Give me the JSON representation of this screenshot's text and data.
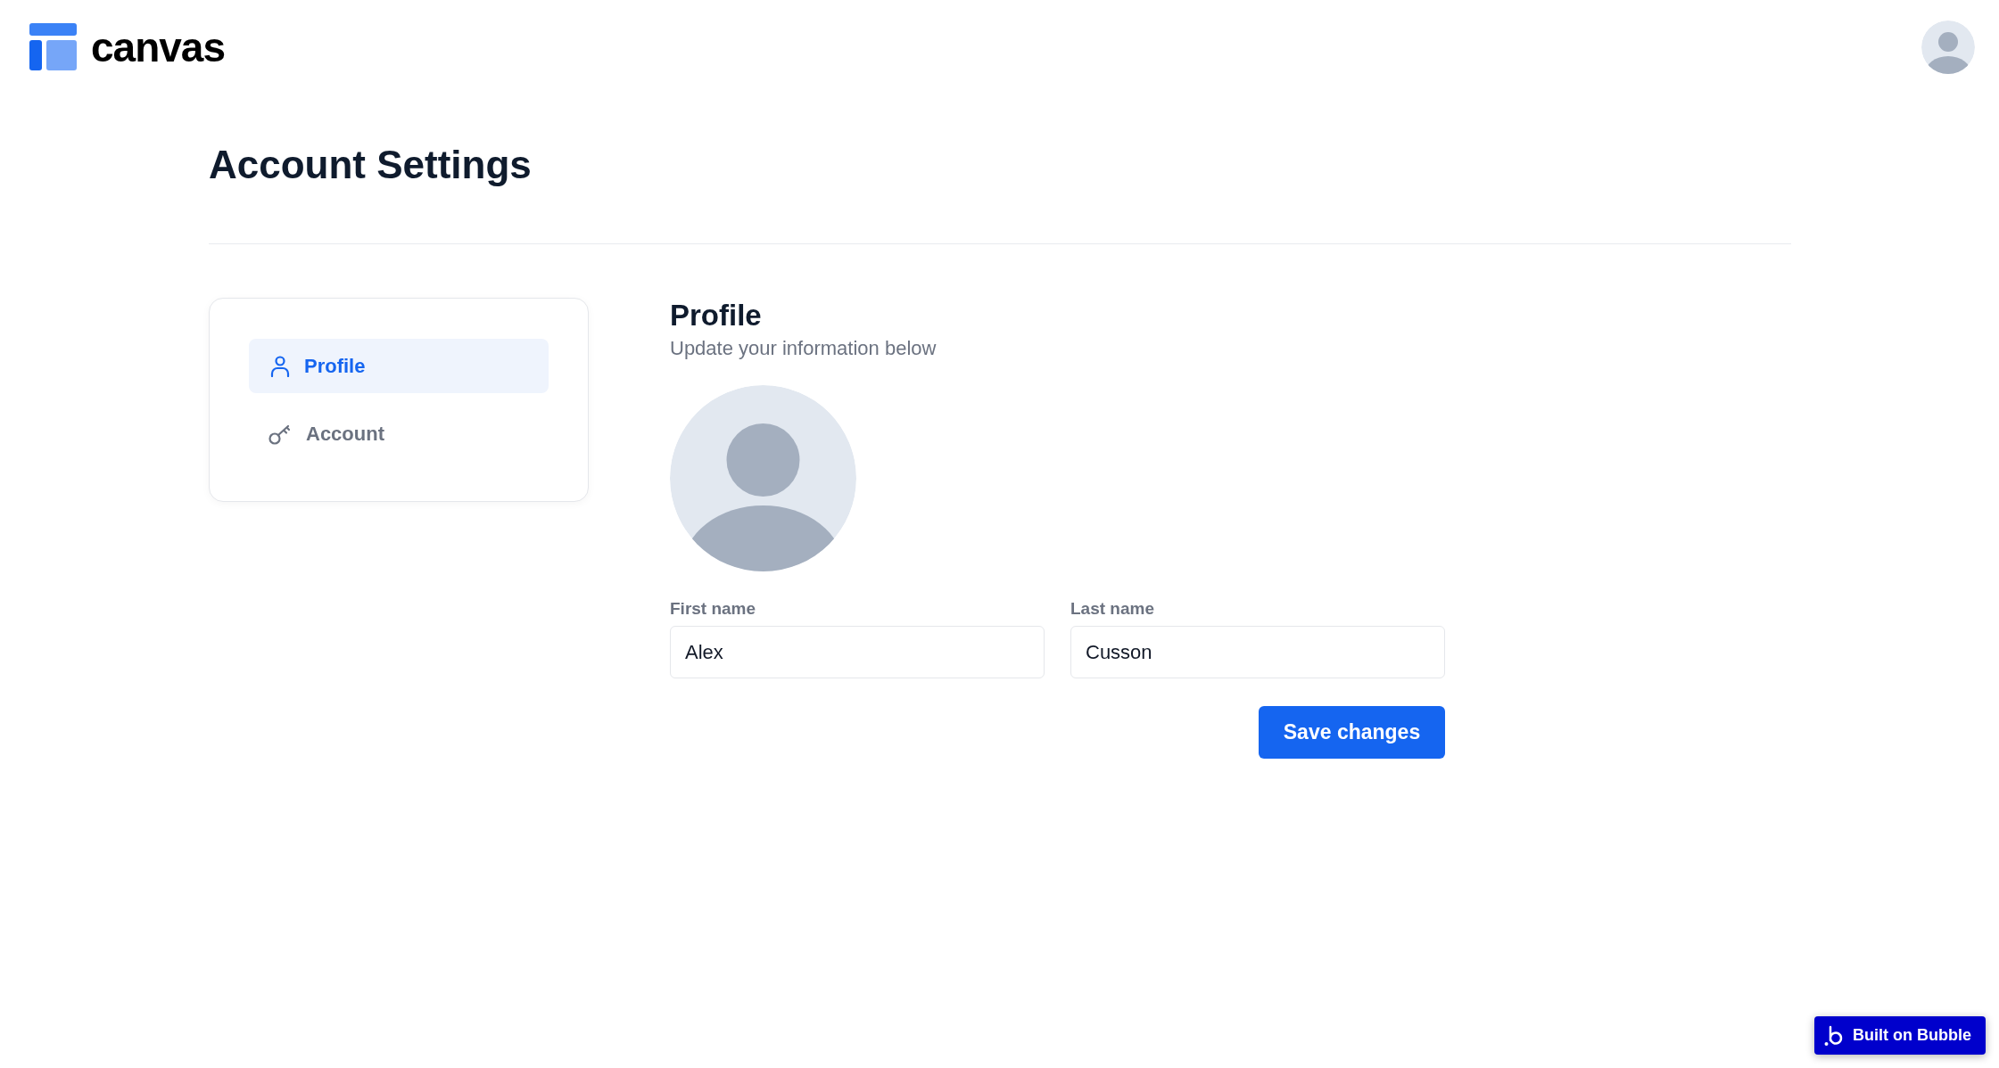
{
  "header": {
    "logo_text": "canvas"
  },
  "page": {
    "title": "Account Settings"
  },
  "sidebar": {
    "items": [
      {
        "kind": "profile",
        "label": "Profile",
        "selected": true
      },
      {
        "kind": "account",
        "label": "Account",
        "selected": false
      }
    ]
  },
  "profile": {
    "title": "Profile",
    "subtitle": "Update your information below",
    "fields": [
      {
        "label": "First name",
        "value": "Alex"
      },
      {
        "label": "Last name",
        "value": "Cusson"
      }
    ],
    "save_button": "Save changes"
  },
  "badge": {
    "label": "Built on Bubble"
  }
}
